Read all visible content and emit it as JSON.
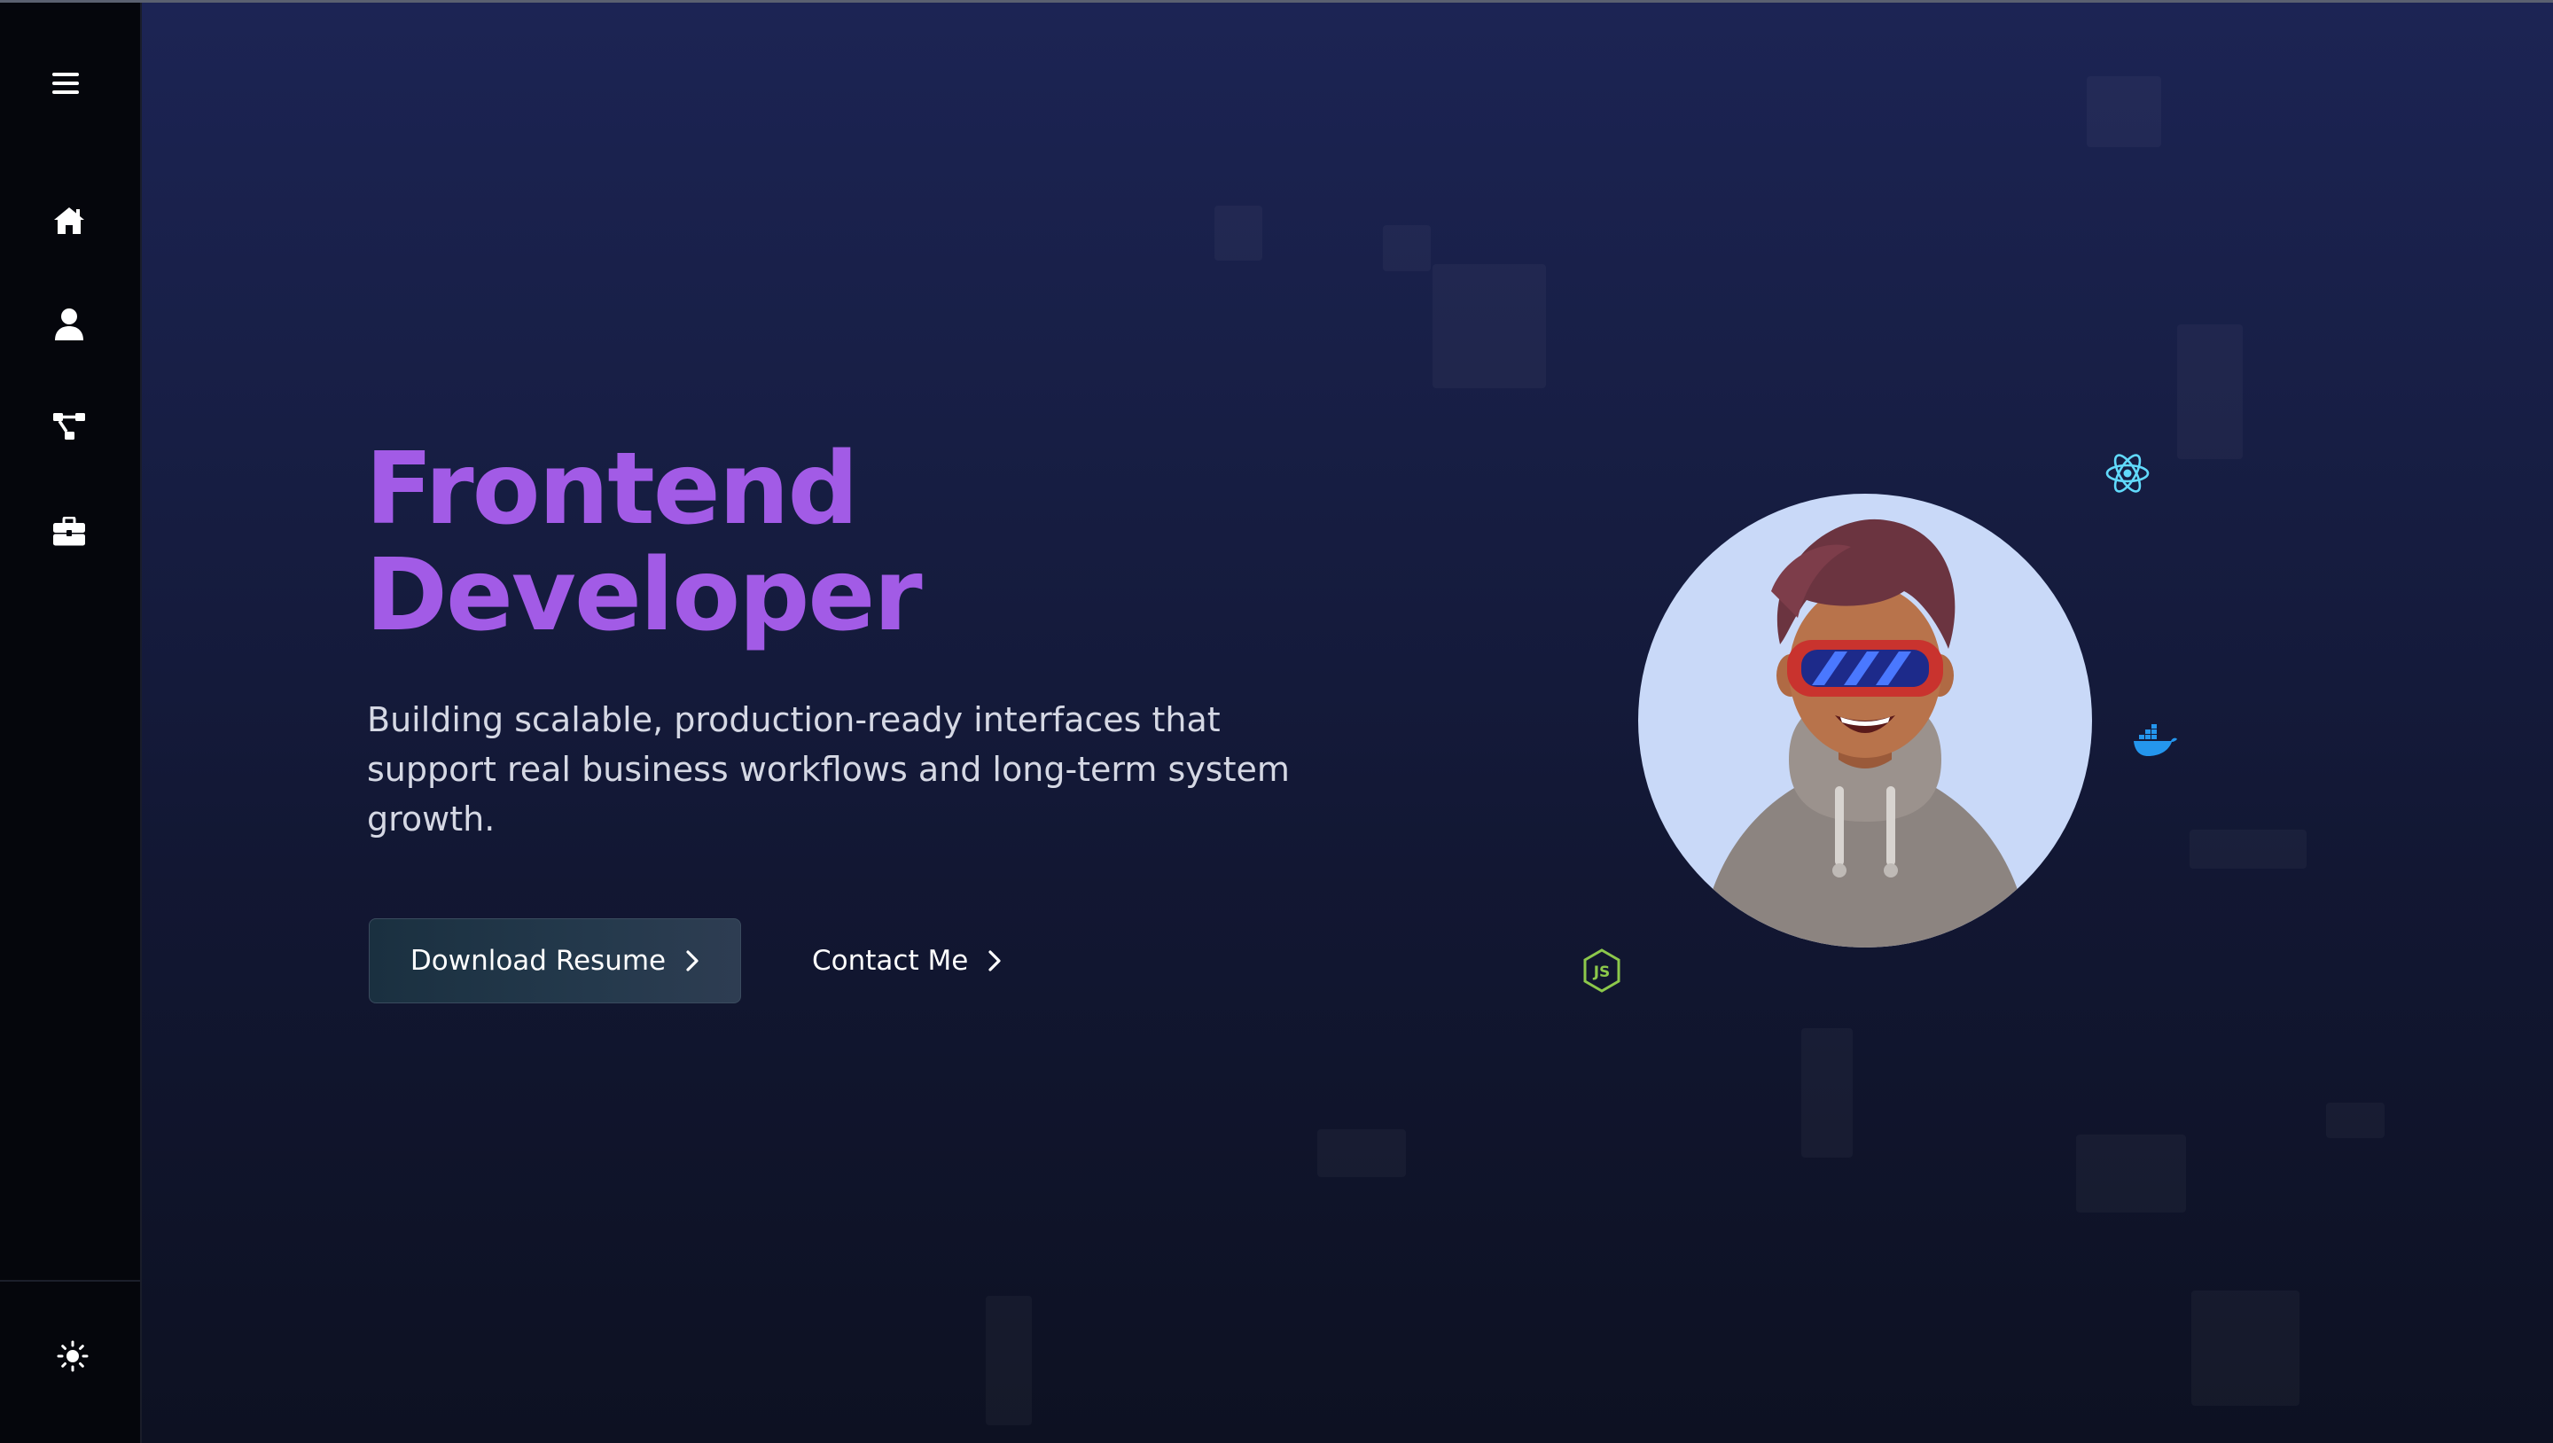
{
  "hero": {
    "title_line1": "Frontend",
    "title_line2": "Developer",
    "description": "Building scalable, production-ready interfaces that support real business workflows and long-term system growth.",
    "primary_button": "Download Resume",
    "secondary_button": "Contact Me"
  },
  "sidebar": {
    "items": [
      {
        "icon": "menu-icon"
      },
      {
        "icon": "home-icon"
      },
      {
        "icon": "user-icon"
      },
      {
        "icon": "sitemap-icon"
      },
      {
        "icon": "briefcase-icon"
      }
    ],
    "theme_toggle": {
      "icon": "sun-icon"
    }
  },
  "floating_icons": [
    "react-icon",
    "docker-icon",
    "nodejs-icon"
  ],
  "colors": {
    "accent": "#a25be6",
    "sidebar_bg": "#05060c",
    "background_top": "#1c2454",
    "background_bottom": "#0d1122",
    "avatar_bg": "#c9d9f8",
    "react": "#61dafb",
    "docker": "#2496ed",
    "nodejs": "#8cc84b"
  }
}
